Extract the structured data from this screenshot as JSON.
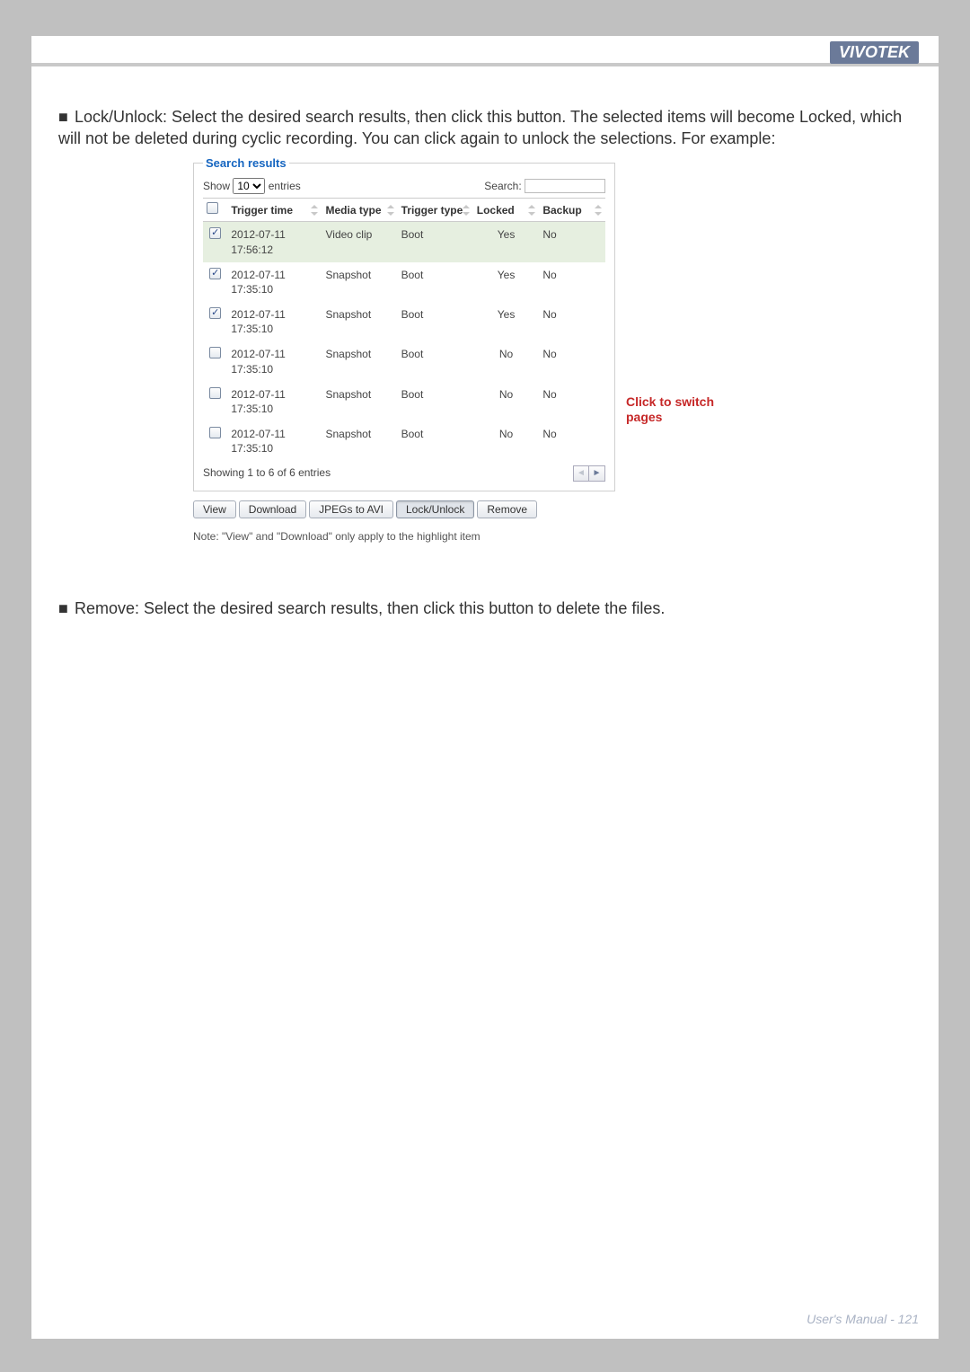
{
  "header": {
    "brand": "VIVOTEK"
  },
  "body": {
    "para1": "Lock/Unlock: Select the desired search results, then click this button. The selected items will become Locked, which will not be deleted during cyclic recording. You can click again to unlock the selections. For example:",
    "para2": "Remove: Select the desired search results, then click this button to delete the files."
  },
  "panel": {
    "legend": "Search results",
    "show_prefix": "Show",
    "show_value": "10",
    "show_suffix": "entries",
    "search_label": "Search:",
    "columns": {
      "trigger_time": "Trigger time",
      "media_type": "Media type",
      "trigger_type": "Trigger type",
      "locked": "Locked",
      "backup": "Backup"
    },
    "rows": [
      {
        "checked": true,
        "highlight": true,
        "time": "2012-07-11 17:56:12",
        "media": "Video clip",
        "trigger": "Boot",
        "locked": "Yes",
        "backup": "No"
      },
      {
        "checked": true,
        "highlight": false,
        "time": "2012-07-11 17:35:10",
        "media": "Snapshot",
        "trigger": "Boot",
        "locked": "Yes",
        "backup": "No"
      },
      {
        "checked": true,
        "highlight": false,
        "time": "2012-07-11 17:35:10",
        "media": "Snapshot",
        "trigger": "Boot",
        "locked": "Yes",
        "backup": "No"
      },
      {
        "checked": false,
        "highlight": false,
        "time": "2012-07-11 17:35:10",
        "media": "Snapshot",
        "trigger": "Boot",
        "locked": "No",
        "backup": "No"
      },
      {
        "checked": false,
        "highlight": false,
        "time": "2012-07-11 17:35:10",
        "media": "Snapshot",
        "trigger": "Boot",
        "locked": "No",
        "backup": "No"
      },
      {
        "checked": false,
        "highlight": false,
        "time": "2012-07-11 17:35:10",
        "media": "Snapshot",
        "trigger": "Boot",
        "locked": "No",
        "backup": "No"
      }
    ],
    "showing_text": "Showing 1 to 6 of 6 entries",
    "buttons": {
      "view": "View",
      "download": "Download",
      "jpegs": "JPEGs to AVI",
      "lockunlock": "Lock/Unlock",
      "remove": "Remove"
    },
    "note": "Note: \"View\" and \"Download\" only apply to the highlight item"
  },
  "callout": "Click to switch pages",
  "footer": {
    "text": "User's Manual - 121"
  }
}
